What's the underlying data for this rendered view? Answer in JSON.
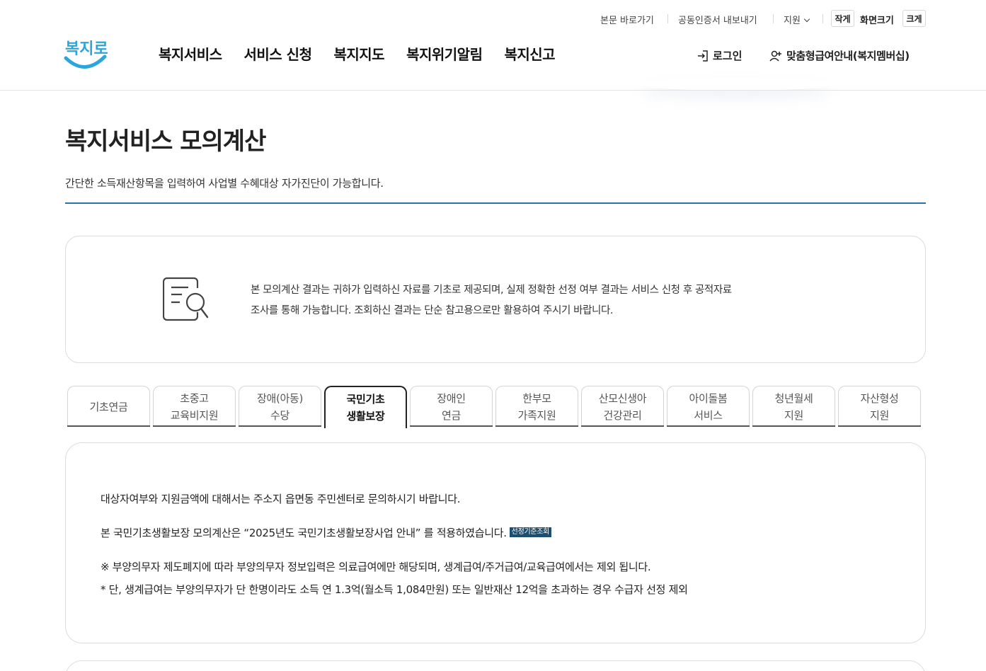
{
  "utility": {
    "skip_link": "본문 바로가기",
    "cert_export": "공동인증서 내보내기",
    "support": "지원",
    "size_small": "작게",
    "size_label": "화면크기",
    "size_large": "크게"
  },
  "logo": {
    "text": "복지로",
    "color": "#2aa6dc"
  },
  "nav": {
    "items": [
      "복지서비스",
      "서비스 신청",
      "복지지도",
      "복지위기알림",
      "복지신고"
    ],
    "login": "로그인",
    "membership": "맞춤형급여안내(복지멤버십)"
  },
  "page": {
    "title": "복지서비스 모의계산",
    "description": "간단한 소득재산항목을 입력하여 사업별 수혜대상 자가진단이 가능합니다.",
    "accent_color": "#2a73a8"
  },
  "notice": {
    "icon": "document-search-icon",
    "line1": "본 모의계산 결과는 귀하가 입력하신 자료를 기초로 제공되며, 실제 정확한 선정 여부 결과는 서비스 신청 후 공적자료",
    "line2": "조사를 통해 가능합니다. 조회하신 결과는 단순 참고용으로만 활용하여 주시기 바랍니다."
  },
  "tabs": [
    {
      "line1": "기초연금",
      "line2": ""
    },
    {
      "line1": "초중고",
      "line2": "교육비지원"
    },
    {
      "line1": "장애(아동)",
      "line2": "수당"
    },
    {
      "line1": "국민기초",
      "line2": "생활보장",
      "active": true
    },
    {
      "line1": "장애인",
      "line2": "연금"
    },
    {
      "line1": "한부모",
      "line2": "가족지원"
    },
    {
      "line1": "산모신생아",
      "line2": "건강관리"
    },
    {
      "line1": "아이돌봄",
      "line2": "서비스"
    },
    {
      "line1": "청년월세",
      "line2": "지원"
    },
    {
      "line1": "자산형성",
      "line2": "지원"
    }
  ],
  "content": {
    "line1": "대상자여부와 지원금액에 대해서는 주소지 읍면동 주민센터로 문의하시기 바랍니다.",
    "line2": "본 국민기초생활보장 모의계산은 “2025년도 국민기초생활보장사업 안내” 를 적용하였습니다.",
    "badge": "선정기준조회",
    "line3": "※ 부양의무자 제도폐지에 따라 부양의무자 정보입력은 의료급여에만 해당되며, 생계급여/주거급여/교육급여에서는 제외 됩니다.",
    "line4": "* 단, 생계급여는 부양의무자가 단 한명이라도 소득 연 1.3억(월소득 1,084만원) 또는 일반재산 12억을 초과하는 경우 수급자 선정 제외"
  }
}
